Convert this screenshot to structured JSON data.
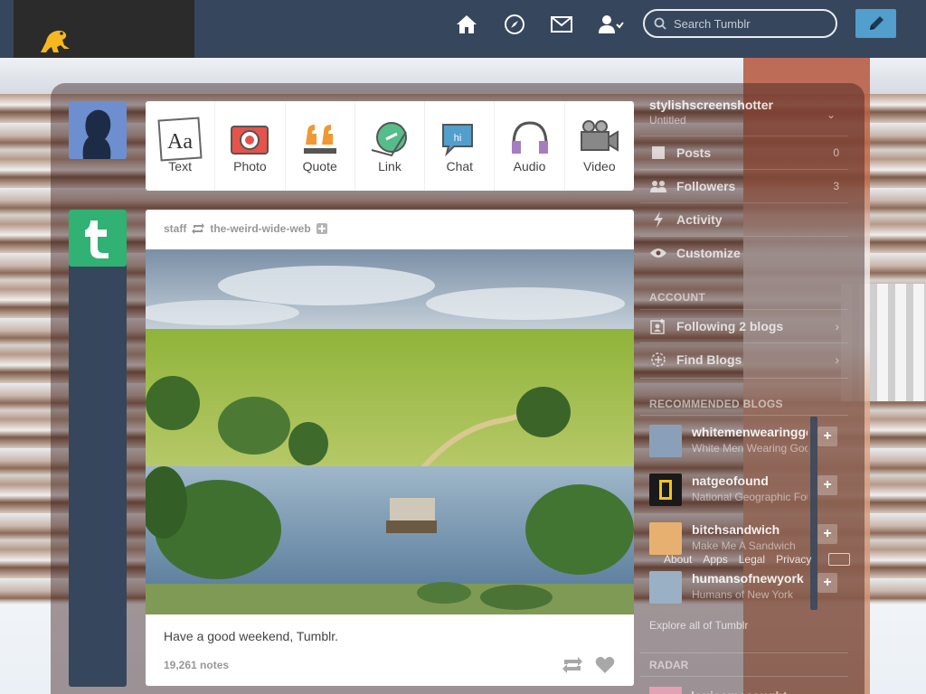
{
  "search": {
    "placeholder": "Search Tumblr"
  },
  "composer": {
    "types": [
      {
        "label": "Text"
      },
      {
        "label": "Photo"
      },
      {
        "label": "Quote"
      },
      {
        "label": "Link"
      },
      {
        "label": "Chat"
      },
      {
        "label": "Audio"
      },
      {
        "label": "Video"
      }
    ]
  },
  "post": {
    "author": "staff",
    "source": "the-weird-wide-web",
    "caption": "Have a good weekend, Tumblr.",
    "notes": "19,261 notes"
  },
  "sidebar": {
    "blog_name": "stylishscreenshotter",
    "blog_subtitle": "Untitled",
    "items": [
      {
        "label": "Posts",
        "count": "0"
      },
      {
        "label": "Followers",
        "count": "3"
      },
      {
        "label": "Activity"
      },
      {
        "label": "Customize"
      }
    ],
    "account_heading": "ACCOUNT",
    "account_items": [
      {
        "label": "Following 2 blogs"
      },
      {
        "label": "Find Blogs"
      }
    ],
    "recommended_heading": "RECOMMENDED BLOGS",
    "recommended": [
      {
        "name": "whitemenwearinggoogleglass",
        "desc": "White Men Wearing Google Glass",
        "color": "#8aa0b8"
      },
      {
        "name": "natgeofound",
        "desc": "National Geographic Found",
        "color": "#1a1a1a"
      },
      {
        "name": "bitchsandwich",
        "desc": "Make Me A Sandwich",
        "color": "#e8b070"
      },
      {
        "name": "humansofnewyork",
        "desc": "Humans of New York",
        "color": "#9ab0c4"
      }
    ],
    "footer_links": [
      "About",
      "Apps",
      "Legal",
      "Privacy"
    ],
    "explore": "Explore all of Tumblr",
    "radar_heading": "RADAR",
    "radar_item": "louisemccaught"
  },
  "colors": {
    "nav": "#36465d",
    "accent": "#529ecc",
    "tumblr_green": "#31b174"
  }
}
